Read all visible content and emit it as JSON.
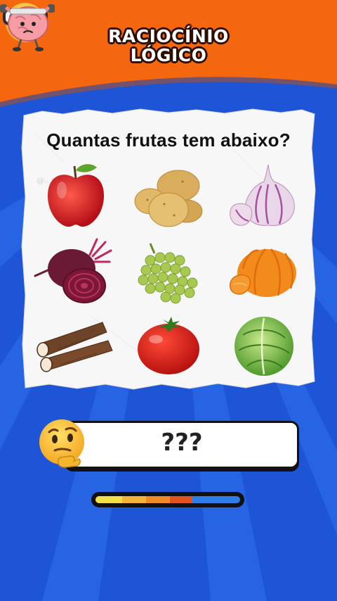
{
  "header": {
    "title_line1": "RACIOCÍNIO",
    "title_line2": "LÓGICO",
    "accent_color": "#f4670f",
    "background_color": "#1d55d6"
  },
  "question": {
    "text": "Quantas frutas tem abaixo?"
  },
  "watermark": "@...tal...",
  "items": [
    {
      "name": "apple-icon"
    },
    {
      "name": "potatoes-icon"
    },
    {
      "name": "garlic-icon"
    },
    {
      "name": "beetroot-icon"
    },
    {
      "name": "grapes-icon"
    },
    {
      "name": "tangerine-icon"
    },
    {
      "name": "cassava-icon"
    },
    {
      "name": "tomato-icon"
    },
    {
      "name": "cabbage-icon"
    }
  ],
  "answer": {
    "text": "???"
  },
  "progress": {
    "filled_fraction": 0.67,
    "colors": [
      "#f2e04b",
      "#f2b53a",
      "#ef8a2a",
      "#e0531f",
      "#2f7de8"
    ]
  }
}
